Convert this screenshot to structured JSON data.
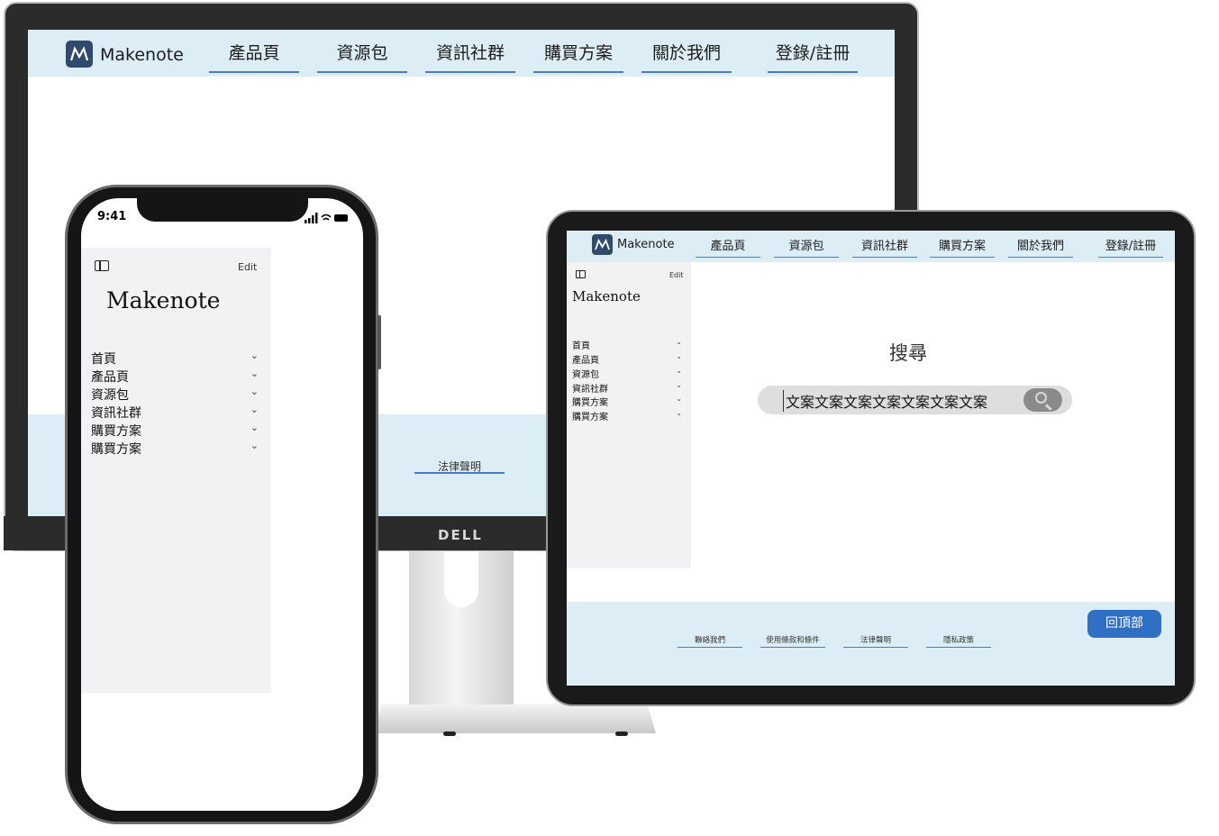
{
  "brand": {
    "name": "Makenote",
    "accent_color": "#4a7bc4",
    "nav_bg": "#dcedf5",
    "logo_icon_color": "#2f4a6b"
  },
  "monitor": {
    "stand_logo": "DELL",
    "nav": {
      "items": [
        "產品頁",
        "資源包",
        "資訊社群",
        "購買方案",
        "關於我們"
      ],
      "login": "登錄/註冊"
    },
    "footer": {
      "links": [
        "法律聲明"
      ]
    }
  },
  "phone": {
    "status": {
      "time": "9:41"
    },
    "sidebar": {
      "edit": "Edit",
      "title": "Makenote",
      "items": [
        "首頁",
        "產品頁",
        "資源包",
        "資訊社群",
        "購買方案",
        "購買方案"
      ],
      "chevron": "⌄"
    }
  },
  "tablet": {
    "nav": {
      "items": [
        "產品頁",
        "資源包",
        "資訊社群",
        "購買方案",
        "關於我們"
      ],
      "login": "登錄/註冊"
    },
    "sidebar": {
      "edit": "Edit",
      "title": "Makenote",
      "items": [
        "首頁",
        "產品頁",
        "資源包",
        "資訊社群",
        "購買方案",
        "購買方案"
      ],
      "chevron": "⌄"
    },
    "search": {
      "title": "搜尋",
      "query": "文案文案文案文案文案文案文案"
    },
    "footer": {
      "links": [
        "聯絡我們",
        "使用條款和條件",
        "法律聲明",
        "隱私政策"
      ],
      "back_to_top": "回頂部"
    }
  }
}
